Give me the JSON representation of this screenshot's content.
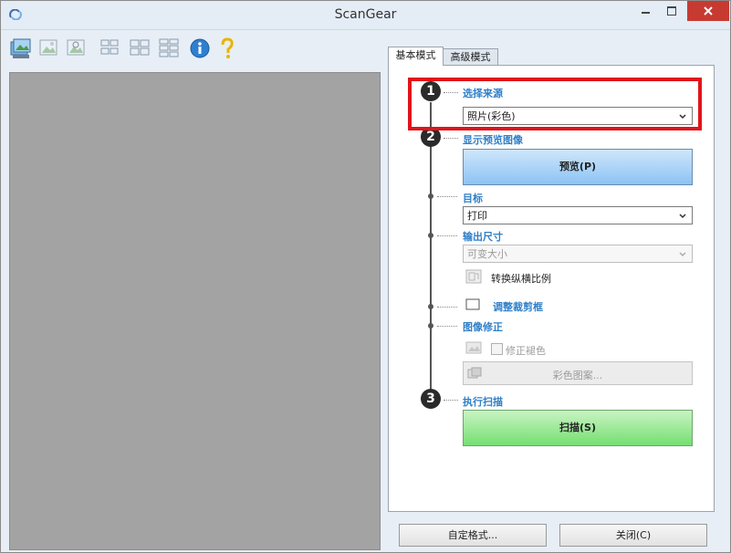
{
  "window": {
    "title": "ScanGear"
  },
  "toolbar": {
    "icons": [
      "photo-scan-icon",
      "image-icon",
      "image-zoom-icon",
      "grid-4-icon",
      "grid-2x2-icon",
      "grid-2x3-icon",
      "info-icon",
      "help-icon"
    ]
  },
  "tabs": [
    {
      "label": "基本模式"
    },
    {
      "label": "高级模式"
    }
  ],
  "steps": {
    "source": {
      "number": "1",
      "label": "选择来源",
      "value": "照片(彩色)"
    },
    "preview": {
      "number": "2",
      "label": "显示预览图像",
      "button": "预览(P)"
    },
    "destination": {
      "label": "目标",
      "value": "打印"
    },
    "output_size": {
      "label": "输出尺寸",
      "value": "可变大小",
      "toggle_label": "转换纵横比例"
    },
    "crop": {
      "label": "调整裁剪框"
    },
    "correction": {
      "label": "图像修正",
      "checkbox_label": "修正褪色",
      "color_button": "彩色图案..."
    },
    "scan": {
      "number": "3",
      "label": "执行扫描",
      "button": "扫描(S)"
    }
  },
  "footer": {
    "custom_format": "自定格式...",
    "close": "关闭(C)"
  },
  "colors": {
    "accent": "#2f7fc8",
    "highlight": "#e0141b",
    "close_button": "#c73a32"
  }
}
